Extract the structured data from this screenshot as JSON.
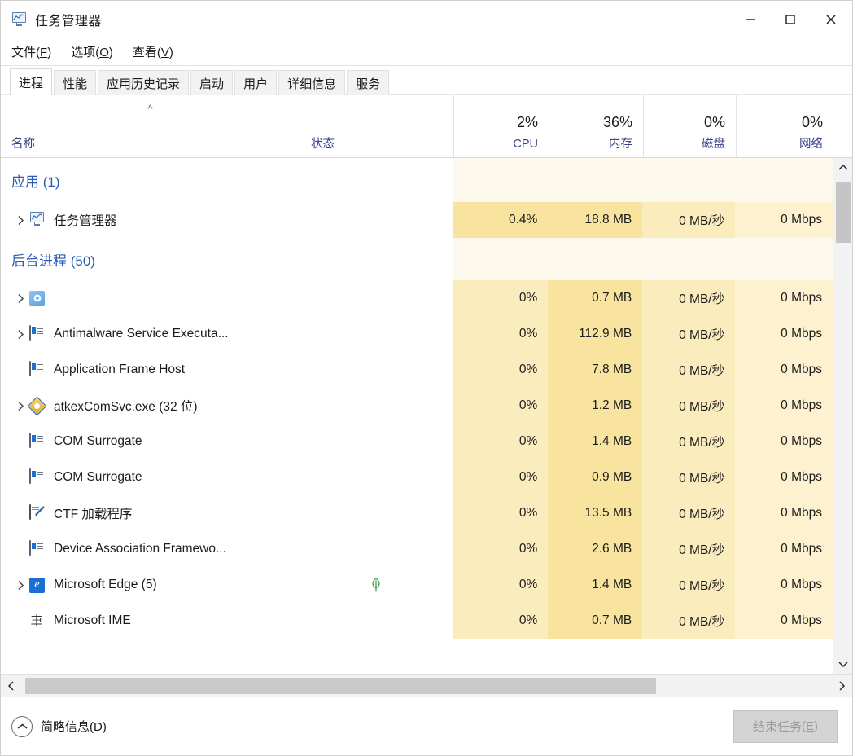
{
  "window": {
    "title": "任务管理器",
    "icon": "task-manager-icon",
    "controls": {
      "minimize": "—",
      "maximize": "□",
      "close": "✕"
    }
  },
  "menu": [
    {
      "label": "文件",
      "mnemonic": "F"
    },
    {
      "label": "选项",
      "mnemonic": "O"
    },
    {
      "label": "查看",
      "mnemonic": "V"
    }
  ],
  "tabs": [
    {
      "label": "进程",
      "active": true
    },
    {
      "label": "性能",
      "active": false
    },
    {
      "label": "应用历史记录",
      "active": false
    },
    {
      "label": "启动",
      "active": false
    },
    {
      "label": "用户",
      "active": false
    },
    {
      "label": "详细信息",
      "active": false
    },
    {
      "label": "服务",
      "active": false
    }
  ],
  "columns": [
    {
      "key": "name",
      "label": "名称",
      "pct": "",
      "sorted": true,
      "sort_glyph": "^"
    },
    {
      "key": "status",
      "label": "状态",
      "pct": ""
    },
    {
      "key": "cpu",
      "label": "CPU",
      "pct": "2%"
    },
    {
      "key": "memory",
      "label": "内存",
      "pct": "36%"
    },
    {
      "key": "disk",
      "label": "磁盘",
      "pct": "0%"
    },
    {
      "key": "network",
      "label": "网络",
      "pct": "0%"
    }
  ],
  "rows": [
    {
      "type": "group",
      "label": "应用 (1)",
      "first": true
    },
    {
      "type": "proc",
      "expandable": true,
      "icon": "task-manager-icon",
      "name": "任务管理器",
      "status": "",
      "cpu": "0.4%",
      "memory": "18.8 MB",
      "disk": "0 MB/秒",
      "network": "0 Mbps",
      "heat": {
        "cpu": "h3",
        "memory": "h3",
        "disk": "h2",
        "network": "h1"
      }
    },
    {
      "type": "group",
      "label": "后台进程 (50)"
    },
    {
      "type": "proc",
      "expandable": true,
      "icon": "blue-square-icon",
      "name": "",
      "status": "",
      "cpu": "0%",
      "memory": "0.7 MB",
      "disk": "0 MB/秒",
      "network": "0 Mbps",
      "heat": {
        "cpu": "h2",
        "memory": "h3",
        "disk": "h2",
        "network": "h1"
      }
    },
    {
      "type": "proc",
      "expandable": true,
      "icon": "process-card-icon",
      "name": "Antimalware Service Executa...",
      "status": "",
      "cpu": "0%",
      "memory": "112.9 MB",
      "disk": "0 MB/秒",
      "network": "0 Mbps",
      "heat": {
        "cpu": "h2",
        "memory": "h3",
        "disk": "h2",
        "network": "h1"
      }
    },
    {
      "type": "proc",
      "expandable": false,
      "icon": "process-card-icon",
      "name": "Application Frame Host",
      "status": "",
      "cpu": "0%",
      "memory": "7.8 MB",
      "disk": "0 MB/秒",
      "network": "0 Mbps",
      "heat": {
        "cpu": "h2",
        "memory": "h3",
        "disk": "h2",
        "network": "h1"
      }
    },
    {
      "type": "proc",
      "expandable": true,
      "icon": "diamond-icon",
      "name": "atkexComSvc.exe (32 位)",
      "status": "",
      "cpu": "0%",
      "memory": "1.2 MB",
      "disk": "0 MB/秒",
      "network": "0 Mbps",
      "heat": {
        "cpu": "h2",
        "memory": "h3",
        "disk": "h2",
        "network": "h1"
      }
    },
    {
      "type": "proc",
      "expandable": false,
      "icon": "process-card-icon",
      "name": "COM Surrogate",
      "status": "",
      "cpu": "0%",
      "memory": "1.4 MB",
      "disk": "0 MB/秒",
      "network": "0 Mbps",
      "heat": {
        "cpu": "h2",
        "memory": "h3",
        "disk": "h2",
        "network": "h1"
      }
    },
    {
      "type": "proc",
      "expandable": false,
      "icon": "process-card-icon",
      "name": "COM Surrogate",
      "status": "",
      "cpu": "0%",
      "memory": "0.9 MB",
      "disk": "0 MB/秒",
      "network": "0 Mbps",
      "heat": {
        "cpu": "h2",
        "memory": "h3",
        "disk": "h2",
        "network": "h1"
      }
    },
    {
      "type": "proc",
      "expandable": false,
      "icon": "ctf-loader-icon",
      "name": "CTF 加载程序",
      "status": "",
      "cpu": "0%",
      "memory": "13.5 MB",
      "disk": "0 MB/秒",
      "network": "0 Mbps",
      "heat": {
        "cpu": "h2",
        "memory": "h3",
        "disk": "h2",
        "network": "h1"
      }
    },
    {
      "type": "proc",
      "expandable": false,
      "icon": "process-card-icon",
      "name": "Device Association Framewo...",
      "status": "",
      "cpu": "0%",
      "memory": "2.6 MB",
      "disk": "0 MB/秒",
      "network": "0 Mbps",
      "heat": {
        "cpu": "h2",
        "memory": "h3",
        "disk": "h2",
        "network": "h1"
      }
    },
    {
      "type": "proc",
      "expandable": true,
      "icon": "edge-icon",
      "name": "Microsoft Edge (5)",
      "status": "leaf-icon",
      "cpu": "0%",
      "memory": "1.4 MB",
      "disk": "0 MB/秒",
      "network": "0 Mbps",
      "heat": {
        "cpu": "h2",
        "memory": "h3",
        "disk": "h2",
        "network": "h1"
      }
    },
    {
      "type": "proc",
      "expandable": false,
      "icon": "ime-icon",
      "name": "Microsoft IME",
      "status": "",
      "cpu": "0%",
      "memory": "0.7 MB",
      "disk": "0 MB/秒",
      "network": "0 Mbps",
      "heat": {
        "cpu": "h2",
        "memory": "h3",
        "disk": "h2",
        "network": "h1"
      }
    }
  ],
  "statusbar": {
    "fewer_details": "简略信息",
    "fewer_mnemonic": "D",
    "end_task": "结束任务",
    "end_task_mnemonic": "E",
    "end_task_disabled": true
  },
  "colors": {
    "group_label": "#2b5bb5",
    "column_label": "#37418c",
    "heat_light": "#fdf8ec",
    "heat_mid": "#fbecbe",
    "heat_strong": "#f8e49f",
    "leaf_green": "#3f9e55"
  }
}
